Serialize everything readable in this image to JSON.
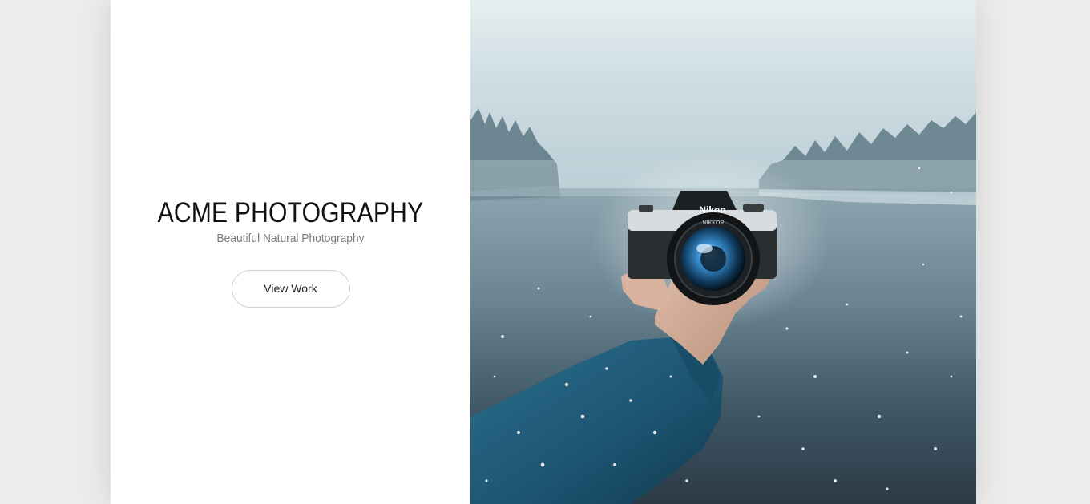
{
  "hero": {
    "title": "ACME PHOTOGRAPHY",
    "subtitle": "Beautiful Natural Photography",
    "cta_label": "View Work"
  },
  "photo": {
    "subject": "hand-holding-camera-over-snowy-lake",
    "camera_brand_text": "Nikon",
    "lens_text": "NIKKOR"
  },
  "colors": {
    "background": "#ececec",
    "panel": "#ffffff",
    "title": "#111111",
    "subtitle": "#7a7a7a",
    "button_border": "#cfcfcf",
    "jacket": "#1f5b78",
    "lake": "#3e5563",
    "sky": "#e2e9ec"
  }
}
